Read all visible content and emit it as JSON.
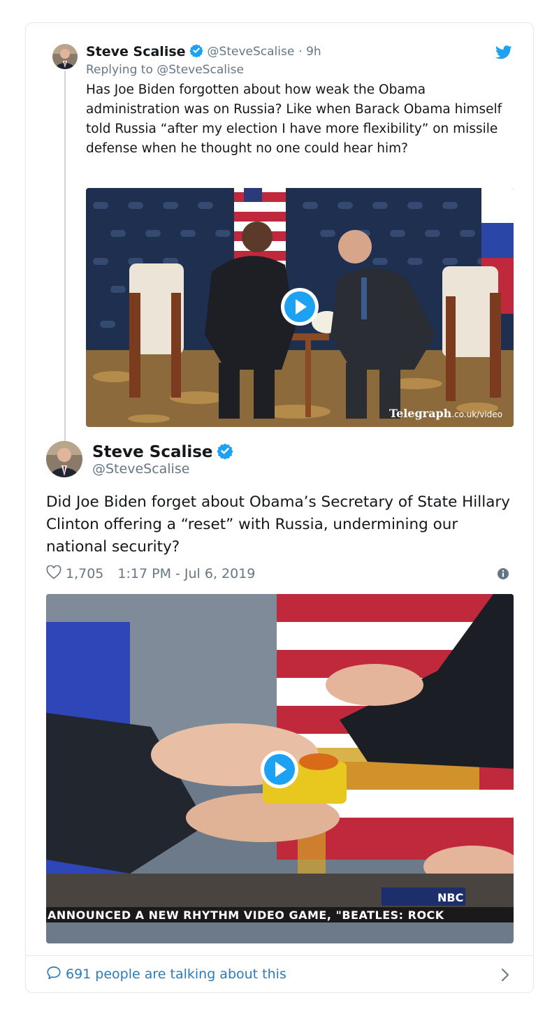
{
  "parent_tweet": {
    "author_name": "Steve Scalise",
    "handle": "@SteveScalise",
    "time_ago": "· 9h",
    "replying_prefix": "Replying to ",
    "replying_to": "@SteveScalise",
    "text": "Has Joe Biden forgotten about how weak the Obama administration was on Russia? Like when Barack Obama himself told Russia “after my election I have more flexibility” on missile defense when he thought no one could hear him?",
    "video_watermark": "Telegraph",
    "video_watermark_sub": ".co.uk/video"
  },
  "main_tweet": {
    "author_name": "Steve Scalise",
    "handle": "@SteveScalise",
    "text": "Did Joe Biden forget about Obama’s Secretary of State Hillary Clinton offering a “reset” with Russia, undermining our national security?",
    "likes": "1,705",
    "timestamp": "1:17 PM - Jul 6, 2019",
    "video_network": "NBC",
    "video_ticker": "ANNOUNCED A NEW RHYTHM VIDEO GAME, \"BEATLES: ROCK"
  },
  "footer": {
    "talking_label": "691 people are talking about this"
  },
  "colors": {
    "twitter_blue": "#1da1f2",
    "link_blue": "#2b7bb9",
    "secondary_text": "#657786",
    "border": "#e1e8ed"
  },
  "icons": {
    "verified": "verified-badge-icon",
    "bird": "twitter-bird-icon",
    "heart": "heart-icon",
    "info": "info-icon",
    "reply": "speech-bubble-icon",
    "chevron": "chevron-right-icon",
    "play": "play-icon"
  }
}
